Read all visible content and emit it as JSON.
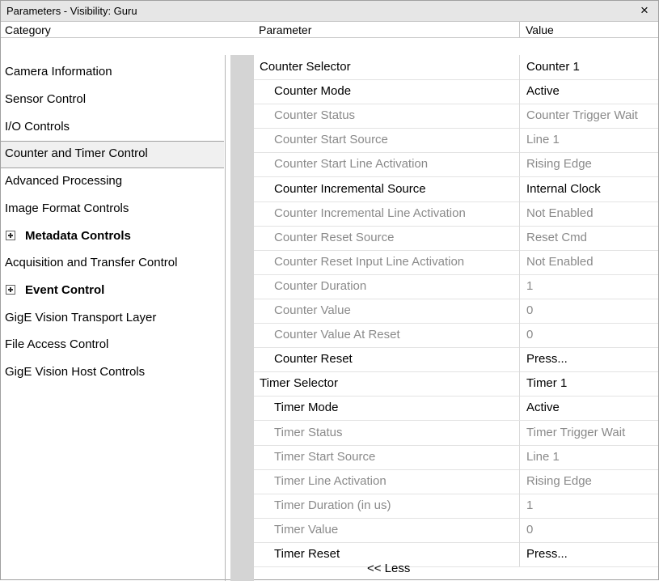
{
  "window": {
    "title": "Parameters - Visibility: Guru",
    "close_glyph": "×"
  },
  "headers": {
    "category": "Category",
    "parameter": "Parameter",
    "value": "Value"
  },
  "categories": [
    {
      "label": "Camera Information",
      "expandable": false
    },
    {
      "label": "Sensor Control",
      "expandable": false
    },
    {
      "label": "I/O Controls",
      "expandable": false
    },
    {
      "label": "Counter and Timer Control",
      "expandable": false,
      "selected": true
    },
    {
      "label": "Advanced Processing",
      "expandable": false
    },
    {
      "label": "Image Format Controls",
      "expandable": false
    },
    {
      "label": "Metadata Controls",
      "expandable": true
    },
    {
      "label": "Acquisition and Transfer Control",
      "expandable": false
    },
    {
      "label": "Event Control",
      "expandable": true
    },
    {
      "label": "GigE Vision Transport Layer",
      "expandable": false
    },
    {
      "label": "File Access Control",
      "expandable": false
    },
    {
      "label": "GigE Vision Host Controls",
      "expandable": false
    }
  ],
  "parameters": [
    {
      "name": "Counter Selector",
      "value": "Counter 1",
      "level": 0,
      "enabled": true
    },
    {
      "name": "Counter Mode",
      "value": "Active",
      "level": 1,
      "enabled": true
    },
    {
      "name": "Counter Status",
      "value": "Counter Trigger Wait",
      "level": 1,
      "enabled": false
    },
    {
      "name": "Counter Start Source",
      "value": "Line 1",
      "level": 1,
      "enabled": false
    },
    {
      "name": "Counter Start Line Activation",
      "value": "Rising Edge",
      "level": 1,
      "enabled": false
    },
    {
      "name": "Counter Incremental Source",
      "value": "Internal Clock",
      "level": 1,
      "enabled": true
    },
    {
      "name": "Counter Incremental Line Activation",
      "value": "Not Enabled",
      "level": 1,
      "enabled": false
    },
    {
      "name": "Counter Reset Source",
      "value": "Reset Cmd",
      "level": 1,
      "enabled": false
    },
    {
      "name": "Counter Reset Input Line Activation",
      "value": "Not Enabled",
      "level": 1,
      "enabled": false
    },
    {
      "name": "Counter Duration",
      "value": "1",
      "level": 1,
      "enabled": false
    },
    {
      "name": "Counter Value",
      "value": "0",
      "level": 1,
      "enabled": false
    },
    {
      "name": "Counter Value At Reset",
      "value": "0",
      "level": 1,
      "enabled": false
    },
    {
      "name": "Counter Reset",
      "value": "Press...",
      "level": 1,
      "enabled": true
    },
    {
      "name": "Timer Selector",
      "value": "Timer 1",
      "level": 0,
      "enabled": true
    },
    {
      "name": "Timer Mode",
      "value": "Active",
      "level": 1,
      "enabled": true
    },
    {
      "name": "Timer Status",
      "value": "Timer Trigger Wait",
      "level": 1,
      "enabled": false
    },
    {
      "name": "Timer Start Source",
      "value": "Line 1",
      "level": 1,
      "enabled": false
    },
    {
      "name": "Timer Line Activation",
      "value": "Rising Edge",
      "level": 1,
      "enabled": false
    },
    {
      "name": "Timer Duration (in us)",
      "value": "1",
      "level": 1,
      "enabled": false
    },
    {
      "name": "Timer Value",
      "value": "0",
      "level": 1,
      "enabled": false
    },
    {
      "name": "Timer Reset",
      "value": "Press...",
      "level": 1,
      "enabled": true
    }
  ],
  "less_link": "<< Less",
  "colors": {
    "enabled_text": "#000000",
    "disabled_text": "#8a8a8a",
    "gutter": "#d4d4d4",
    "titlebar": "#e6e6e6"
  }
}
